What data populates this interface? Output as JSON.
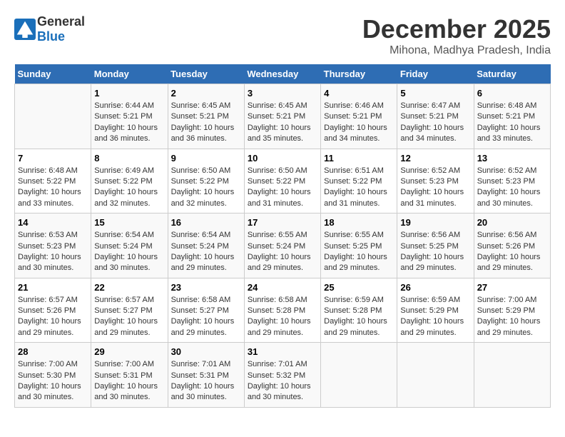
{
  "logo": {
    "general": "General",
    "blue": "Blue"
  },
  "title": "December 2025",
  "subtitle": "Mihona, Madhya Pradesh, India",
  "days_header": [
    "Sunday",
    "Monday",
    "Tuesday",
    "Wednesday",
    "Thursday",
    "Friday",
    "Saturday"
  ],
  "weeks": [
    [
      {
        "day": "",
        "info": ""
      },
      {
        "day": "1",
        "info": "Sunrise: 6:44 AM\nSunset: 5:21 PM\nDaylight: 10 hours\nand 36 minutes."
      },
      {
        "day": "2",
        "info": "Sunrise: 6:45 AM\nSunset: 5:21 PM\nDaylight: 10 hours\nand 36 minutes."
      },
      {
        "day": "3",
        "info": "Sunrise: 6:45 AM\nSunset: 5:21 PM\nDaylight: 10 hours\nand 35 minutes."
      },
      {
        "day": "4",
        "info": "Sunrise: 6:46 AM\nSunset: 5:21 PM\nDaylight: 10 hours\nand 34 minutes."
      },
      {
        "day": "5",
        "info": "Sunrise: 6:47 AM\nSunset: 5:21 PM\nDaylight: 10 hours\nand 34 minutes."
      },
      {
        "day": "6",
        "info": "Sunrise: 6:48 AM\nSunset: 5:21 PM\nDaylight: 10 hours\nand 33 minutes."
      }
    ],
    [
      {
        "day": "7",
        "info": "Sunrise: 6:48 AM\nSunset: 5:22 PM\nDaylight: 10 hours\nand 33 minutes."
      },
      {
        "day": "8",
        "info": "Sunrise: 6:49 AM\nSunset: 5:22 PM\nDaylight: 10 hours\nand 32 minutes."
      },
      {
        "day": "9",
        "info": "Sunrise: 6:50 AM\nSunset: 5:22 PM\nDaylight: 10 hours\nand 32 minutes."
      },
      {
        "day": "10",
        "info": "Sunrise: 6:50 AM\nSunset: 5:22 PM\nDaylight: 10 hours\nand 31 minutes."
      },
      {
        "day": "11",
        "info": "Sunrise: 6:51 AM\nSunset: 5:22 PM\nDaylight: 10 hours\nand 31 minutes."
      },
      {
        "day": "12",
        "info": "Sunrise: 6:52 AM\nSunset: 5:23 PM\nDaylight: 10 hours\nand 31 minutes."
      },
      {
        "day": "13",
        "info": "Sunrise: 6:52 AM\nSunset: 5:23 PM\nDaylight: 10 hours\nand 30 minutes."
      }
    ],
    [
      {
        "day": "14",
        "info": "Sunrise: 6:53 AM\nSunset: 5:23 PM\nDaylight: 10 hours\nand 30 minutes."
      },
      {
        "day": "15",
        "info": "Sunrise: 6:54 AM\nSunset: 5:24 PM\nDaylight: 10 hours\nand 30 minutes."
      },
      {
        "day": "16",
        "info": "Sunrise: 6:54 AM\nSunset: 5:24 PM\nDaylight: 10 hours\nand 29 minutes."
      },
      {
        "day": "17",
        "info": "Sunrise: 6:55 AM\nSunset: 5:24 PM\nDaylight: 10 hours\nand 29 minutes."
      },
      {
        "day": "18",
        "info": "Sunrise: 6:55 AM\nSunset: 5:25 PM\nDaylight: 10 hours\nand 29 minutes."
      },
      {
        "day": "19",
        "info": "Sunrise: 6:56 AM\nSunset: 5:25 PM\nDaylight: 10 hours\nand 29 minutes."
      },
      {
        "day": "20",
        "info": "Sunrise: 6:56 AM\nSunset: 5:26 PM\nDaylight: 10 hours\nand 29 minutes."
      }
    ],
    [
      {
        "day": "21",
        "info": "Sunrise: 6:57 AM\nSunset: 5:26 PM\nDaylight: 10 hours\nand 29 minutes."
      },
      {
        "day": "22",
        "info": "Sunrise: 6:57 AM\nSunset: 5:27 PM\nDaylight: 10 hours\nand 29 minutes."
      },
      {
        "day": "23",
        "info": "Sunrise: 6:58 AM\nSunset: 5:27 PM\nDaylight: 10 hours\nand 29 minutes."
      },
      {
        "day": "24",
        "info": "Sunrise: 6:58 AM\nSunset: 5:28 PM\nDaylight: 10 hours\nand 29 minutes."
      },
      {
        "day": "25",
        "info": "Sunrise: 6:59 AM\nSunset: 5:28 PM\nDaylight: 10 hours\nand 29 minutes."
      },
      {
        "day": "26",
        "info": "Sunrise: 6:59 AM\nSunset: 5:29 PM\nDaylight: 10 hours\nand 29 minutes."
      },
      {
        "day": "27",
        "info": "Sunrise: 7:00 AM\nSunset: 5:29 PM\nDaylight: 10 hours\nand 29 minutes."
      }
    ],
    [
      {
        "day": "28",
        "info": "Sunrise: 7:00 AM\nSunset: 5:30 PM\nDaylight: 10 hours\nand 30 minutes."
      },
      {
        "day": "29",
        "info": "Sunrise: 7:00 AM\nSunset: 5:31 PM\nDaylight: 10 hours\nand 30 minutes."
      },
      {
        "day": "30",
        "info": "Sunrise: 7:01 AM\nSunset: 5:31 PM\nDaylight: 10 hours\nand 30 minutes."
      },
      {
        "day": "31",
        "info": "Sunrise: 7:01 AM\nSunset: 5:32 PM\nDaylight: 10 hours\nand 30 minutes."
      },
      {
        "day": "",
        "info": ""
      },
      {
        "day": "",
        "info": ""
      },
      {
        "day": "",
        "info": ""
      }
    ]
  ]
}
